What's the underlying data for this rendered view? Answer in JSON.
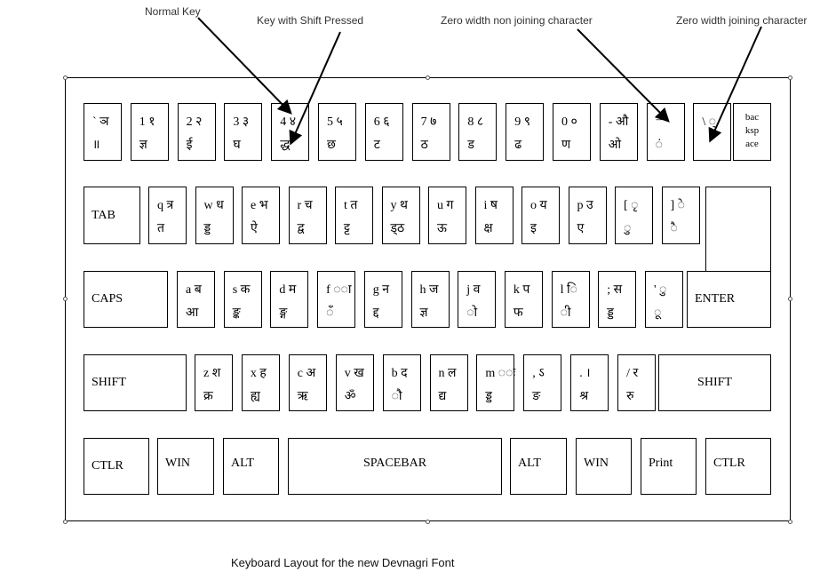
{
  "callouts": {
    "normal_key": "Normal Key",
    "shift_key": "Key with Shift Pressed",
    "zwnj": "Zero width non joining character",
    "zwj": "Zero width joining character"
  },
  "caption": "Keyboard Layout for the new Devnagri Font",
  "rows": {
    "number_row": [
      {
        "normal": "` ञ",
        "shift": "॥"
      },
      {
        "normal": "1 १",
        "shift": "ज्ञ"
      },
      {
        "normal": "2 २",
        "shift": "ई"
      },
      {
        "normal": "3 ३",
        "shift": "घ"
      },
      {
        "normal": "4 ४",
        "shift": "द्ध"
      },
      {
        "normal": "5 ५",
        "shift": "छ"
      },
      {
        "normal": "6 ६",
        "shift": "ट"
      },
      {
        "normal": "7 ७",
        "shift": "ठ"
      },
      {
        "normal": "8 ८",
        "shift": "ड"
      },
      {
        "normal": "9 ९",
        "shift": "ढ"
      },
      {
        "normal": "0 ०",
        "shift": "ण"
      },
      {
        "normal": "- औ",
        "shift": "ओ"
      },
      {
        "normal": "=",
        "shift": "◌ं"
      },
      {
        "normal": "\\ ◌्",
        "shift": ""
      }
    ],
    "backspace": "bac\nksp\nace",
    "tab": "TAB",
    "qwerty_row": [
      {
        "normal": "q त्र",
        "shift": "त"
      },
      {
        "normal": "w ध",
        "shift": "ड्ड"
      },
      {
        "normal": "e भ",
        "shift": "ऐ"
      },
      {
        "normal": "r च",
        "shift": "द्व"
      },
      {
        "normal": "t त",
        "shift": "ट्ट"
      },
      {
        "normal": "y थ",
        "shift": "ड्ठ"
      },
      {
        "normal": "u ग",
        "shift": "ऊ"
      },
      {
        "normal": "i ष",
        "shift": "क्ष"
      },
      {
        "normal": "o य",
        "shift": "इ"
      },
      {
        "normal": "p उ",
        "shift": "ए"
      },
      {
        "normal": "[ ◌ृ",
        "shift": "◌ु"
      },
      {
        "normal": "] ◌े",
        "shift": "◌ै"
      }
    ],
    "caps": "CAPS",
    "home_row": [
      {
        "normal": "a ब",
        "shift": "आ"
      },
      {
        "normal": "s क",
        "shift": "ङ्क"
      },
      {
        "normal": "d म",
        "shift": "ङ्ग"
      },
      {
        "normal": "f ◌ा",
        "shift": "◌ँ"
      },
      {
        "normal": "g न",
        "shift": "द्द"
      },
      {
        "normal": "h ज",
        "shift": "ज्ञ"
      },
      {
        "normal": "j व",
        "shift": "◌ो"
      },
      {
        "normal": "k प",
        "shift": "फ"
      },
      {
        "normal": "l ि",
        "shift": "◌ी"
      },
      {
        "normal": "; स",
        "shift": "ड्ड"
      },
      {
        "normal": "' ◌ु",
        "shift": "◌ू"
      }
    ],
    "enter": "ENTER",
    "shift_left": "SHIFT",
    "bottom_row": [
      {
        "normal": "z श",
        "shift": "क्र"
      },
      {
        "normal": "x ह",
        "shift": "ह्य"
      },
      {
        "normal": "c अ",
        "shift": "ऋ"
      },
      {
        "normal": "v ख",
        "shift": "ॐ"
      },
      {
        "normal": "b द",
        "shift": "◌ौ"
      },
      {
        "normal": "n ल",
        "shift": "द्य"
      },
      {
        "normal": "m ◌ः",
        "shift": "ड्ड"
      },
      {
        "normal": ", ऽ",
        "shift": "ङ"
      },
      {
        "normal": ". ।",
        "shift": "श्र"
      },
      {
        "normal": "/ र",
        "shift": "रु"
      }
    ],
    "shift_right": "SHIFT",
    "control_row": {
      "ctrl_left": "CTLR",
      "win_left": "WIN",
      "alt_left": "ALT",
      "spacebar": "SPACEBAR",
      "alt_right": "ALT",
      "win_right": "WIN",
      "print": "Print",
      "ctrl_right": "CTLR"
    }
  }
}
